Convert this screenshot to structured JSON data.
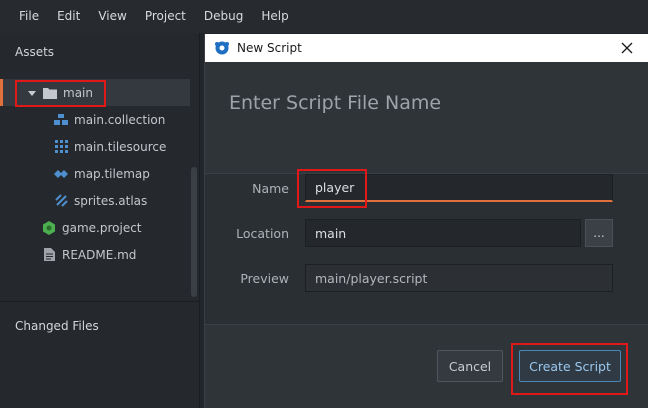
{
  "menubar": {
    "items": [
      "File",
      "Edit",
      "View",
      "Project",
      "Debug",
      "Help"
    ]
  },
  "assets": {
    "title": "Assets",
    "tree": [
      {
        "label": "main",
        "icon": "folder-icon",
        "type": "folder",
        "expanded": true,
        "selected": true
      },
      {
        "label": "main.collection",
        "icon": "collection-icon",
        "type": "file"
      },
      {
        "label": "main.tilesource",
        "icon": "tilesource-icon",
        "type": "file"
      },
      {
        "label": "map.tilemap",
        "icon": "tilemap-icon",
        "type": "file"
      },
      {
        "label": "sprites.atlas",
        "icon": "atlas-icon",
        "type": "file"
      },
      {
        "label": "game.project",
        "icon": "project-icon",
        "type": "file"
      },
      {
        "label": "README.md",
        "icon": "document-icon",
        "type": "file"
      }
    ]
  },
  "changed_files": {
    "title": "Changed Files"
  },
  "dialog": {
    "title": "New Script",
    "header": "Enter Script File Name",
    "name_label": "Name",
    "name_value": "player",
    "location_label": "Location",
    "location_value": "main",
    "browse_label": "...",
    "preview_label": "Preview",
    "preview_value": "main/player.script",
    "cancel_label": "Cancel",
    "create_label": "Create Script"
  },
  "colors": {
    "accent_orange": "#e0703c",
    "highlight_red": "#e01818",
    "primary_blue": "#4a87b8"
  }
}
